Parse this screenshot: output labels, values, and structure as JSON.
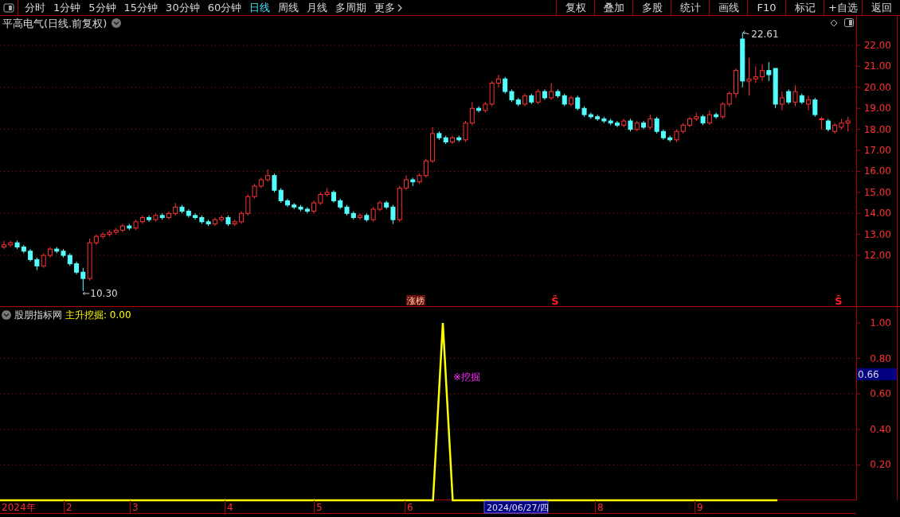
{
  "toolbar": {
    "tabs": [
      {
        "label": "分时",
        "selected": false
      },
      {
        "label": "1分钟",
        "selected": false
      },
      {
        "label": "5分钟",
        "selected": false
      },
      {
        "label": "15分钟",
        "selected": false
      },
      {
        "label": "30分钟",
        "selected": false
      },
      {
        "label": "60分钟",
        "selected": false
      },
      {
        "label": "日线",
        "selected": true
      },
      {
        "label": "周线",
        "selected": false
      },
      {
        "label": "月线",
        "selected": false
      },
      {
        "label": "多周期",
        "selected": false
      },
      {
        "label": "更多",
        "selected": false
      }
    ],
    "buttons": [
      "复权",
      "叠加",
      "多股",
      "统计",
      "画线",
      "F10",
      "标记",
      "+自选",
      "返回"
    ]
  },
  "price_pane": {
    "title": "平高电气(日线.前复权)",
    "high_label": "22.61",
    "low_label": "10.30",
    "markers": [
      {
        "text": "涨榜",
        "kind": "badge"
      },
      {
        "text": "Ŝ",
        "kind": "signal"
      },
      {
        "text": "Ŝ",
        "kind": "signal"
      }
    ],
    "chart_data": {
      "type": "candlestick",
      "ylim": [
        9.58,
        23.4
      ],
      "grid": true,
      "yticks": [
        {
          "value": 12,
          "label": "12.00"
        },
        {
          "value": 13,
          "label": "13.00"
        },
        {
          "value": 14,
          "label": "14.00"
        },
        {
          "value": 15,
          "label": "15.00"
        },
        {
          "value": 16,
          "label": "16.00"
        },
        {
          "value": 17,
          "label": "17.00"
        },
        {
          "value": 18,
          "label": "18.00"
        },
        {
          "value": 19,
          "label": "19.00"
        },
        {
          "value": 20,
          "label": "20.00"
        },
        {
          "value": 21,
          "label": "21.00"
        },
        {
          "value": 22,
          "label": "22.00"
        }
      ],
      "ohlc": [
        [
          12.4,
          12.7,
          12.3,
          12.5
        ],
        [
          12.5,
          12.7,
          12.4,
          12.6
        ],
        [
          12.6,
          12.7,
          12.3,
          12.4
        ],
        [
          12.4,
          12.5,
          12.1,
          12.2
        ],
        [
          12.2,
          12.3,
          11.7,
          11.8
        ],
        [
          11.8,
          11.9,
          11.3,
          11.5
        ],
        [
          11.5,
          12.1,
          11.4,
          12.0
        ],
        [
          12.0,
          12.4,
          11.9,
          12.3
        ],
        [
          12.3,
          12.4,
          12.1,
          12.2
        ],
        [
          12.2,
          12.3,
          11.9,
          12.0
        ],
        [
          12.0,
          12.1,
          11.5,
          11.6
        ],
        [
          11.6,
          11.7,
          11.1,
          11.2
        ],
        [
          11.2,
          11.4,
          10.3,
          10.9
        ],
        [
          10.9,
          12.8,
          10.8,
          12.6
        ],
        [
          12.6,
          13.0,
          12.5,
          12.9
        ],
        [
          12.9,
          13.1,
          12.8,
          13.0
        ],
        [
          13.0,
          13.2,
          12.9,
          13.1
        ],
        [
          13.1,
          13.3,
          13.0,
          13.2
        ],
        [
          13.2,
          13.5,
          13.1,
          13.4
        ],
        [
          13.4,
          13.5,
          13.2,
          13.3
        ],
        [
          13.3,
          13.7,
          13.2,
          13.6
        ],
        [
          13.6,
          13.9,
          13.5,
          13.8
        ],
        [
          13.8,
          13.9,
          13.6,
          13.7
        ],
        [
          13.7,
          14.0,
          13.6,
          13.9
        ],
        [
          13.9,
          14.0,
          13.7,
          13.8
        ],
        [
          13.8,
          14.1,
          13.7,
          14.0
        ],
        [
          14.0,
          14.5,
          13.9,
          14.3
        ],
        [
          14.3,
          14.4,
          14.0,
          14.1
        ],
        [
          14.1,
          14.2,
          13.8,
          13.9
        ],
        [
          13.9,
          14.0,
          13.7,
          13.8
        ],
        [
          13.8,
          13.9,
          13.5,
          13.6
        ],
        [
          13.6,
          13.7,
          13.4,
          13.5
        ],
        [
          13.5,
          13.8,
          13.4,
          13.7
        ],
        [
          13.7,
          13.9,
          13.6,
          13.8
        ],
        [
          13.8,
          13.9,
          13.4,
          13.5
        ],
        [
          13.5,
          13.7,
          13.4,
          13.6
        ],
        [
          13.6,
          14.1,
          13.5,
          14.0
        ],
        [
          14.0,
          14.9,
          13.9,
          14.8
        ],
        [
          14.8,
          15.4,
          14.7,
          15.3
        ],
        [
          15.3,
          15.7,
          15.2,
          15.6
        ],
        [
          15.6,
          16.1,
          15.5,
          15.8
        ],
        [
          15.8,
          15.9,
          15.0,
          15.1
        ],
        [
          15.1,
          15.2,
          14.5,
          14.6
        ],
        [
          14.6,
          14.7,
          14.3,
          14.4
        ],
        [
          14.4,
          14.5,
          14.2,
          14.3
        ],
        [
          14.3,
          14.4,
          14.1,
          14.2
        ],
        [
          14.2,
          14.3,
          14.0,
          14.1
        ],
        [
          14.1,
          14.6,
          14.0,
          14.5
        ],
        [
          14.5,
          15.0,
          14.4,
          14.9
        ],
        [
          14.9,
          15.2,
          14.8,
          15.0
        ],
        [
          15.0,
          15.1,
          14.5,
          14.6
        ],
        [
          14.6,
          14.7,
          14.2,
          14.3
        ],
        [
          14.3,
          14.4,
          13.9,
          14.0
        ],
        [
          14.0,
          14.1,
          13.7,
          13.8
        ],
        [
          13.8,
          14.0,
          13.7,
          13.9
        ],
        [
          13.9,
          14.0,
          13.6,
          13.7
        ],
        [
          13.7,
          14.3,
          13.6,
          14.2
        ],
        [
          14.2,
          14.6,
          14.1,
          14.5
        ],
        [
          14.5,
          14.6,
          14.2,
          14.3
        ],
        [
          14.3,
          14.4,
          13.5,
          13.7
        ],
        [
          13.7,
          15.3,
          13.6,
          15.2
        ],
        [
          15.2,
          15.8,
          15.1,
          15.6
        ],
        [
          15.6,
          15.7,
          15.3,
          15.5
        ],
        [
          15.5,
          15.9,
          15.4,
          15.8
        ],
        [
          15.8,
          16.6,
          15.7,
          16.5
        ],
        [
          16.5,
          18.1,
          16.4,
          17.8
        ],
        [
          17.8,
          17.9,
          17.5,
          17.6
        ],
        [
          17.6,
          17.7,
          17.3,
          17.4
        ],
        [
          17.4,
          17.7,
          17.3,
          17.6
        ],
        [
          17.6,
          17.7,
          17.4,
          17.5
        ],
        [
          17.5,
          18.4,
          17.4,
          18.3
        ],
        [
          18.3,
          19.3,
          18.2,
          19.0
        ],
        [
          19.0,
          19.1,
          18.8,
          18.9
        ],
        [
          18.9,
          19.3,
          18.8,
          19.2
        ],
        [
          19.2,
          20.3,
          19.1,
          20.2
        ],
        [
          20.2,
          20.6,
          20.0,
          20.4
        ],
        [
          20.4,
          20.5,
          19.7,
          19.8
        ],
        [
          19.8,
          19.9,
          19.3,
          19.4
        ],
        [
          19.4,
          19.5,
          19.1,
          19.2
        ],
        [
          19.2,
          19.7,
          19.1,
          19.6
        ],
        [
          19.6,
          19.7,
          19.2,
          19.3
        ],
        [
          19.3,
          19.9,
          19.2,
          19.8
        ],
        [
          19.8,
          19.9,
          19.4,
          19.5
        ],
        [
          19.5,
          20.2,
          19.4,
          19.8
        ],
        [
          19.8,
          19.9,
          19.5,
          19.6
        ],
        [
          19.6,
          19.7,
          19.1,
          19.2
        ],
        [
          19.2,
          19.6,
          19.1,
          19.5
        ],
        [
          19.5,
          19.6,
          18.9,
          19.0
        ],
        [
          19.0,
          19.1,
          18.6,
          18.7
        ],
        [
          18.7,
          18.8,
          18.5,
          18.6
        ],
        [
          18.6,
          18.7,
          18.4,
          18.5
        ],
        [
          18.5,
          18.6,
          18.3,
          18.4
        ],
        [
          18.4,
          18.5,
          18.2,
          18.3
        ],
        [
          18.3,
          18.4,
          18.1,
          18.2
        ],
        [
          18.2,
          18.5,
          18.1,
          18.4
        ],
        [
          18.4,
          18.5,
          17.9,
          18.0
        ],
        [
          18.0,
          18.4,
          17.9,
          18.3
        ],
        [
          18.3,
          18.4,
          18.0,
          18.1
        ],
        [
          18.1,
          18.7,
          18.0,
          18.5
        ],
        [
          18.5,
          18.6,
          17.8,
          17.9
        ],
        [
          17.9,
          18.0,
          17.5,
          17.6
        ],
        [
          17.6,
          17.7,
          17.4,
          17.5
        ],
        [
          17.5,
          18.0,
          17.4,
          17.9
        ],
        [
          17.9,
          18.3,
          17.8,
          18.2
        ],
        [
          18.2,
          18.6,
          18.1,
          18.5
        ],
        [
          18.5,
          18.8,
          18.4,
          18.6
        ],
        [
          18.6,
          18.7,
          18.2,
          18.3
        ],
        [
          18.3,
          18.9,
          18.2,
          18.7
        ],
        [
          18.7,
          18.8,
          18.5,
          18.6
        ],
        [
          18.6,
          19.3,
          18.5,
          19.2
        ],
        [
          19.2,
          19.8,
          19.1,
          19.7
        ],
        [
          19.7,
          20.9,
          19.5,
          20.8
        ],
        [
          22.3,
          22.61,
          20.0,
          20.3
        ],
        [
          20.3,
          21.4,
          19.6,
          20.4
        ],
        [
          20.4,
          21.0,
          20.2,
          20.5
        ],
        [
          20.5,
          21.1,
          20.3,
          20.8
        ],
        [
          20.8,
          21.2,
          20.3,
          20.6
        ],
        [
          20.9,
          20.9,
          19.0,
          19.2
        ],
        [
          19.2,
          19.8,
          18.9,
          19.5
        ],
        [
          19.8,
          19.9,
          19.2,
          19.3
        ],
        [
          19.3,
          20.1,
          19.1,
          19.8
        ],
        [
          19.6,
          19.7,
          19.2,
          19.3
        ],
        [
          19.2,
          19.6,
          18.9,
          19.4
        ],
        [
          19.4,
          19.5,
          18.6,
          18.7
        ],
        [
          18.5,
          18.6,
          18.0,
          18.5
        ],
        [
          18.4,
          18.5,
          17.9,
          18.0
        ],
        [
          17.9,
          18.3,
          17.8,
          18.2
        ],
        [
          18.1,
          18.5,
          18.0,
          18.3
        ],
        [
          18.3,
          18.6,
          17.9,
          18.4
        ]
      ]
    }
  },
  "indicator_pane": {
    "source": "股朋指标网",
    "reading": ": 0.00",
    "signal_label": "※挖掘",
    "current_value": "0.66",
    "chart_data": {
      "type": "line",
      "ylim": [
        0,
        1
      ],
      "grid": true,
      "yticks": [
        {
          "value": 0.2,
          "label": "0.20"
        },
        {
          "value": 0.4,
          "label": "0.40"
        },
        {
          "value": 0.6,
          "label": "0.60"
        },
        {
          "value": 0.8,
          "label": "0.80"
        },
        {
          "value": 1.0,
          "label": "1.00"
        }
      ],
      "series": [
        {
          "name": "主升挖掘",
          "color": "#ffff00",
          "values": [
            0,
            0,
            0,
            0,
            0,
            0,
            0,
            0,
            0,
            0,
            0,
            0,
            0,
            0,
            0,
            0,
            0,
            0,
            0,
            0,
            0,
            0,
            0,
            0,
            0,
            0,
            0,
            0,
            0,
            0,
            0,
            0,
            0,
            0,
            0,
            0,
            0,
            0,
            0,
            0,
            0,
            0,
            0,
            0,
            0,
            1,
            0,
            0,
            0,
            0,
            0,
            0,
            0,
            0,
            0,
            0,
            0,
            0,
            0,
            0,
            0,
            0,
            0,
            0,
            0,
            0,
            0,
            0,
            0,
            0,
            0,
            0,
            0,
            0,
            0,
            0,
            0,
            0,
            0,
            0,
            null,
            null,
            null,
            null,
            null,
            null,
            null,
            null
          ]
        }
      ]
    }
  },
  "date_axis": {
    "labels": [
      "2024年",
      "2",
      "3",
      "4",
      "5",
      "6",
      "8",
      "9"
    ],
    "cursor_date": "2024/06/27/四"
  }
}
